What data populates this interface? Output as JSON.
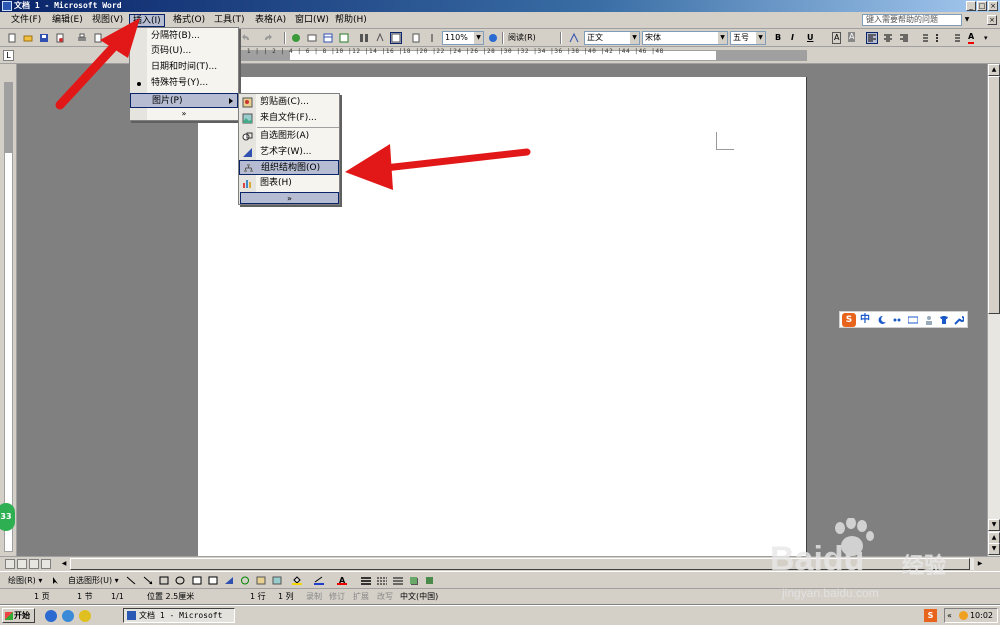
{
  "window": {
    "title": "文档 1 - Microsoft Word"
  },
  "menubar": {
    "items": [
      "文件(F)",
      "编辑(E)",
      "视图(V)",
      "插入(I)",
      "格式(O)",
      "工具(T)",
      "表格(A)",
      "窗口(W)",
      "帮助(H)"
    ],
    "active_index": 3,
    "help_placeholder": "键入需要帮助的问题"
  },
  "toolbar": {
    "zoom": "110%",
    "read_label": "阅读(R)",
    "style": "正文",
    "font": "宋体",
    "size": "五号",
    "bold": "B",
    "italic": "I",
    "underline": "U",
    "a_label": "A",
    "font_color_label": "A"
  },
  "ruler": {
    "ticks": "2 | 1 |  | 2 | 4 | 6 | 8 |10 |12 |14 |16 |18 |20 |22 |24 |26 |28 |30 |32 |34 |36 |38 |40 |42 |44 |46 |48"
  },
  "insert_menu": {
    "items": [
      {
        "label": "分隔符(B)..."
      },
      {
        "label": "页码(U)..."
      },
      {
        "label": "日期和时间(T)..."
      },
      {
        "label": "特殊符号(Y)..."
      },
      {
        "label": "图片(P)"
      }
    ],
    "expand": "»"
  },
  "picture_submenu": {
    "items": [
      {
        "label": "剪贴画(C)...",
        "icon": "clipart-icon"
      },
      {
        "label": "来自文件(F)...",
        "icon": "image-file-icon"
      },
      {
        "label": "自选图形(A)",
        "icon": "autoshape-icon"
      },
      {
        "label": "艺术字(W)...",
        "icon": "wordart-icon"
      },
      {
        "label": "组织结构图(O)",
        "icon": "org-chart-icon"
      },
      {
        "label": "图表(H)",
        "icon": "chart-icon"
      }
    ],
    "highlighted_index": 4,
    "expand": "»"
  },
  "drawbar": {
    "draw_label": "绘图(R) ▾",
    "autoshape_label": "自选图形(U) ▾"
  },
  "statusbar": {
    "page": "1 页",
    "section": "1 节",
    "pages": "1/1",
    "position": "位置 2.5厘米",
    "line": "1 行",
    "column": "1 列",
    "rec": "录制",
    "trk": "修订",
    "ext": "扩展",
    "ovr": "改写",
    "language": "中文(中国)"
  },
  "taskbar": {
    "start": "开始",
    "doc_button": "文档 1 - Microsoft ...",
    "clock": "10:02",
    "tray_prefix": "«"
  },
  "ime": {
    "logo": "S",
    "mode": "中"
  },
  "badge": {
    "value": "33"
  },
  "watermark": {
    "brand": "Baidu",
    "brand_cn": "经验",
    "url": "jingyan.baidu.com"
  },
  "colors": {
    "accent": "#0a246a",
    "highlight": "#b6bdd2",
    "arrow": "#e21818",
    "titlebar": "#0a246a"
  }
}
